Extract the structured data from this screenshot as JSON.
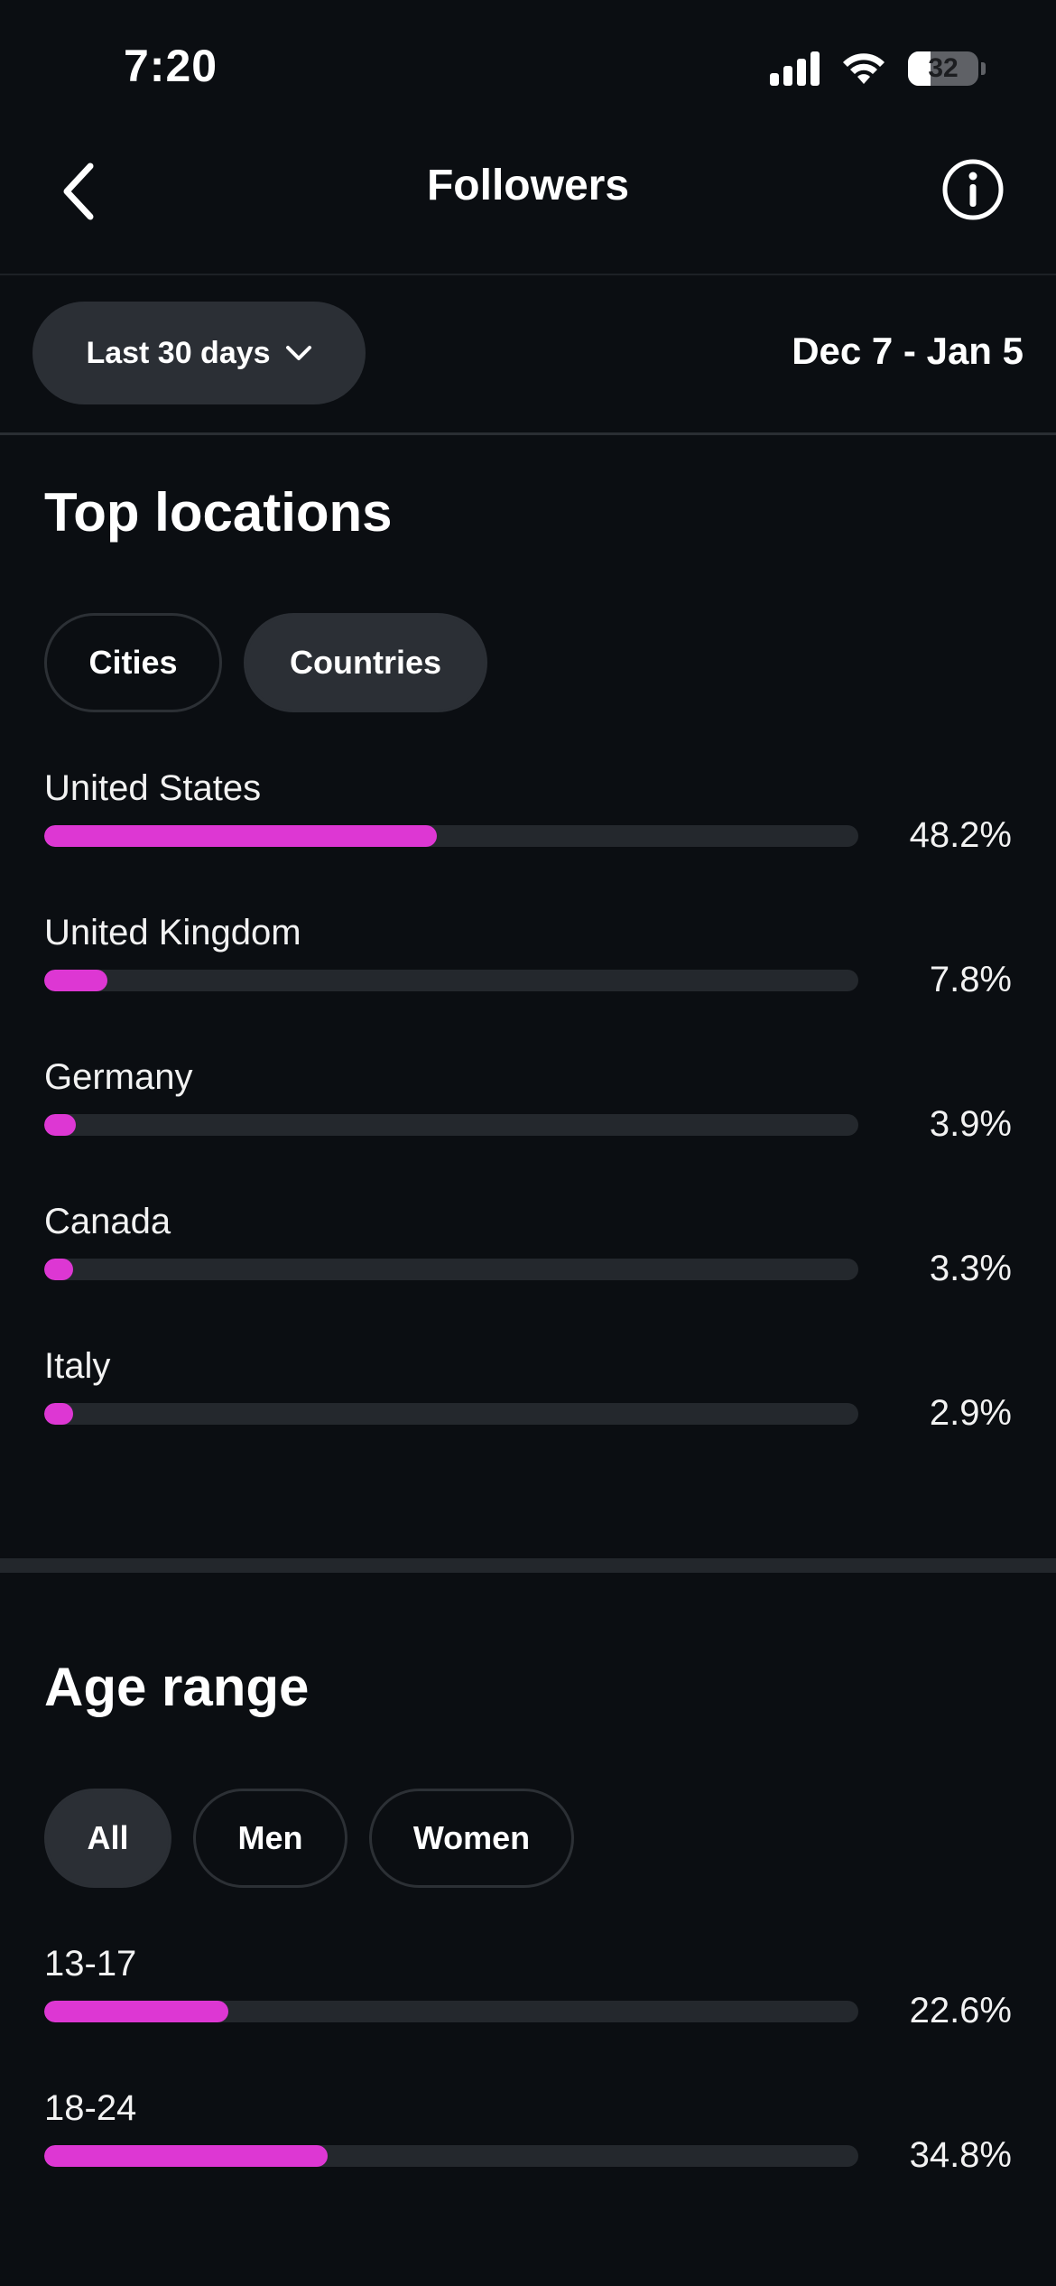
{
  "status_bar": {
    "time": "7:20",
    "battery_percent": "32",
    "battery_level": 0.32,
    "icons": [
      "cellular-signal-icon",
      "wifi-icon",
      "battery-icon"
    ]
  },
  "header": {
    "title": "Followers",
    "back_icon": "chevron-left-icon",
    "info_icon": "info-icon"
  },
  "filter": {
    "range_label": "Last 30 days",
    "date_range": "Dec 7 - Jan 5"
  },
  "top_locations": {
    "title": "Top locations",
    "tabs": [
      {
        "label": "Cities",
        "active": false
      },
      {
        "label": "Countries",
        "active": true
      }
    ],
    "items": [
      {
        "label": "United States",
        "value": "48.2%",
        "percent": 48.2
      },
      {
        "label": "United Kingdom",
        "value": "7.8%",
        "percent": 7.8
      },
      {
        "label": "Germany",
        "value": "3.9%",
        "percent": 3.9
      },
      {
        "label": "Canada",
        "value": "3.3%",
        "percent": 3.3
      },
      {
        "label": "Italy",
        "value": "2.9%",
        "percent": 2.9
      }
    ]
  },
  "age_range": {
    "title": "Age range",
    "tabs": [
      {
        "label": "All",
        "active": true
      },
      {
        "label": "Men",
        "active": false
      },
      {
        "label": "Women",
        "active": false
      }
    ],
    "items": [
      {
        "label": "13-17",
        "value": "22.6%",
        "percent": 22.6
      },
      {
        "label": "18-24",
        "value": "34.8%",
        "percent": 34.8
      }
    ]
  },
  "colors": {
    "background": "#0b0e12",
    "bar_fill": "#dd37d3",
    "bar_track": "#24282d",
    "chip_active": "#2b2f35"
  }
}
